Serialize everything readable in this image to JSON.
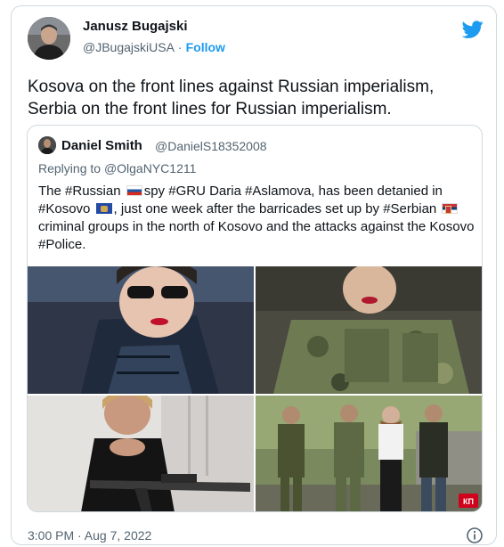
{
  "author": {
    "name": "Janusz Bugajski",
    "handle": "@JBugajskiUSA",
    "separator": "·",
    "follow_label": "Follow"
  },
  "tweet_text": "Kosova on the front lines against Russian imperialism, Serbia on the front lines for Russian imperialism.",
  "quote": {
    "name": "Daniel Smith",
    "handle": "@DanielS18352008",
    "replying_prefix": "Replying to ",
    "replying_to": "@OlgaNYC1211",
    "text_1": "The #Russian ",
    "text_2": "spy #GRU Daria #Aslamova, has been detanied in #Kosovo ",
    "text_3": ", just one week after the barricades set up by #Serbian ",
    "text_4": " criminal groups in the north of Kosovo and the attacks against the Kosovo #Police.",
    "watermark": "КП"
  },
  "timestamp": "3:00 PM · Aug 7, 2022",
  "icons": {
    "brand": "twitter-bird-icon",
    "info": "info-icon"
  },
  "colors": {
    "brand": "#1d9bf0",
    "secondary_text": "#536471",
    "border": "#cfd9de"
  }
}
